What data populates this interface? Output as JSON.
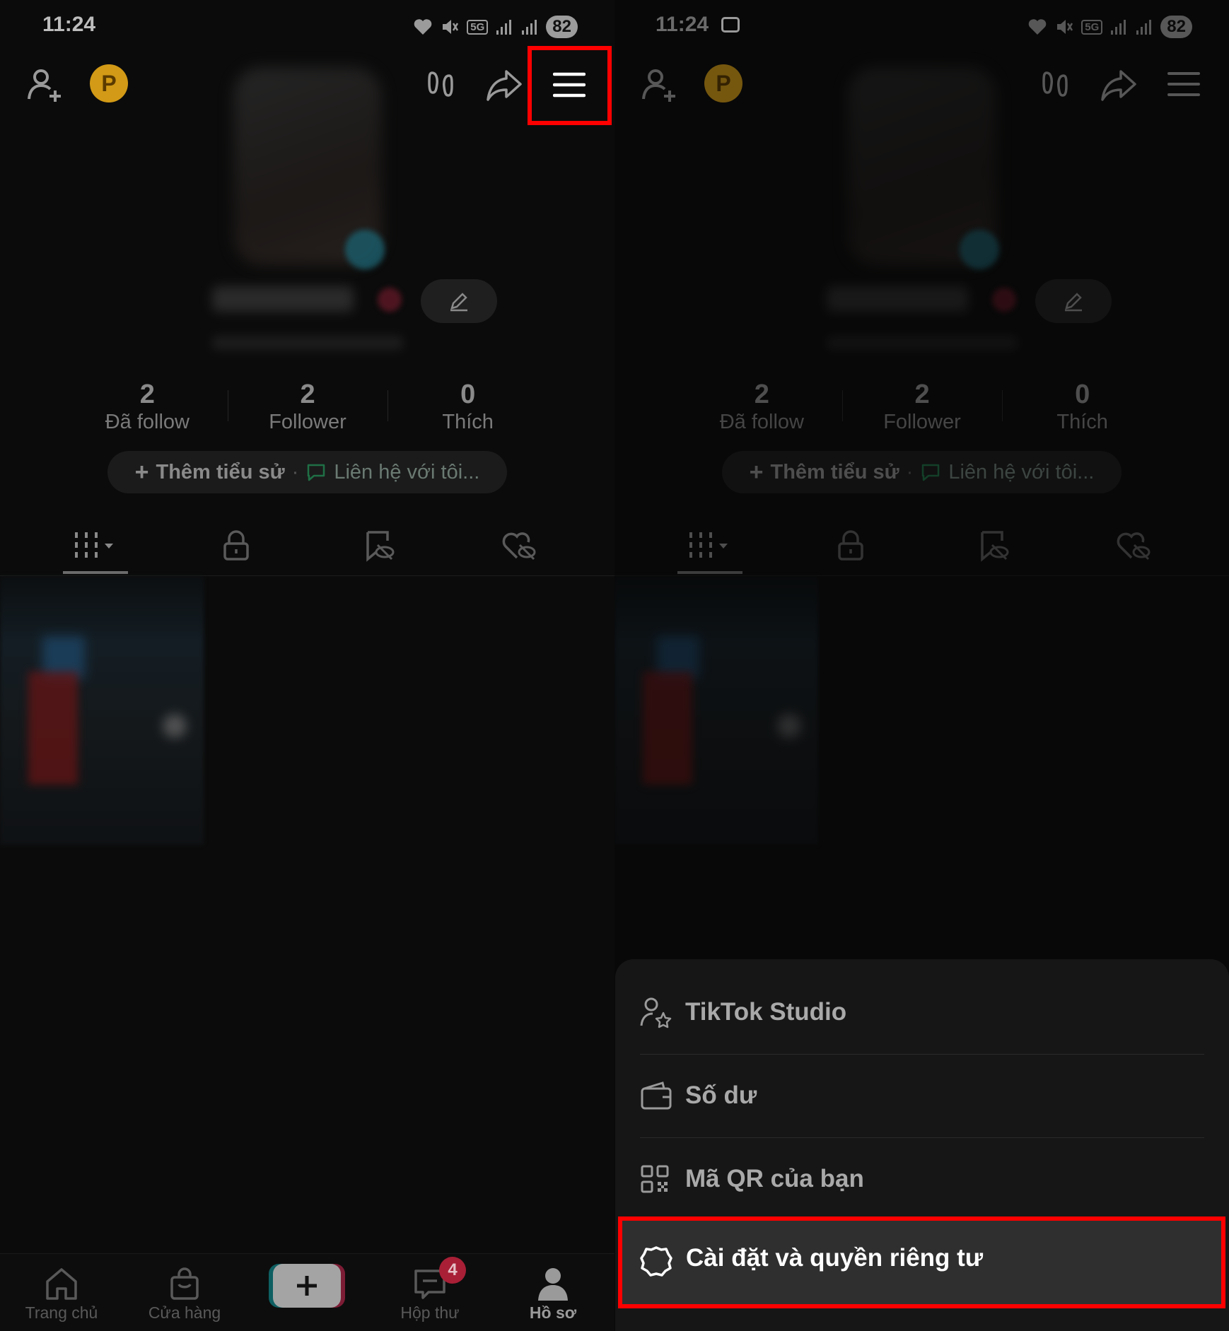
{
  "status_bar": {
    "time": "11:24",
    "network": "5G",
    "battery": "82"
  },
  "profile": {
    "stats": [
      {
        "value": "2",
        "label": "Đã follow"
      },
      {
        "value": "2",
        "label": "Follower"
      },
      {
        "value": "0",
        "label": "Thích"
      }
    ],
    "bio_add": "Thêm tiểu sử",
    "bio_separator": "·",
    "contact": "Liên hệ với tôi..."
  },
  "bottom_nav": {
    "home": "Trang chủ",
    "shop": "Cửa hàng",
    "inbox": "Hộp thư",
    "inbox_badge": "4",
    "profile": "Hồ sơ"
  },
  "menu_sheet": {
    "items": [
      {
        "label": "TikTok Studio",
        "icon": "person-star-icon"
      },
      {
        "label": "Số dư",
        "icon": "wallet-icon"
      },
      {
        "label": "Mã QR của bạn",
        "icon": "qr-code-icon"
      },
      {
        "label": "Cài đặt và quyền riêng tư",
        "icon": "gear-icon"
      }
    ]
  },
  "colors": {
    "highlight": "#ff0000",
    "coin": "#d29a16",
    "badge": "#a81f36"
  }
}
